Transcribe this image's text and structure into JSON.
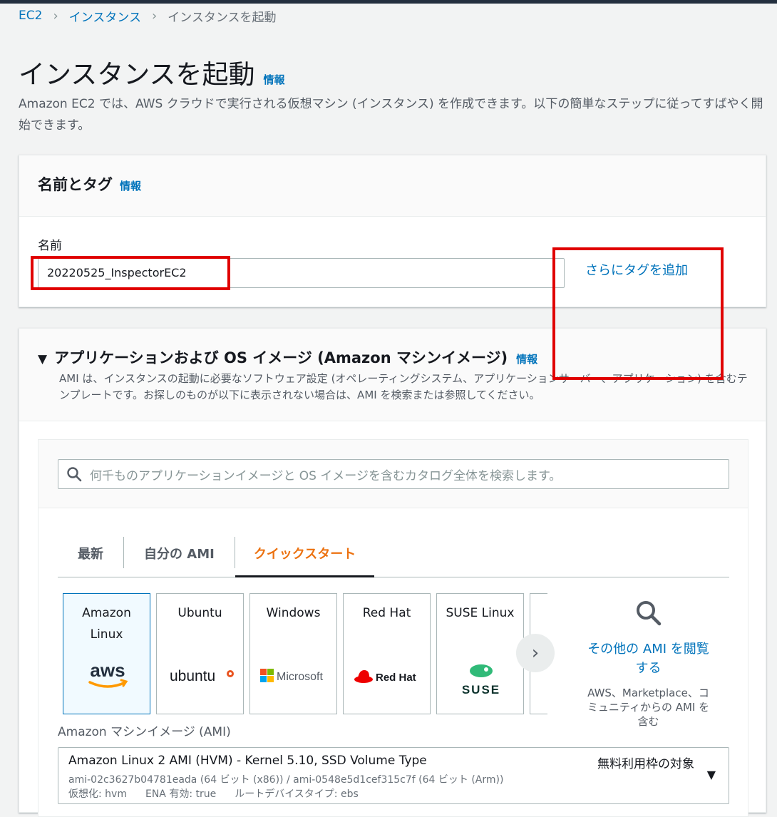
{
  "breadcrumb": {
    "item1": "EC2",
    "item2": "インスタンス",
    "current": "インスタンスを起動"
  },
  "header": {
    "title": "インスタンスを起動",
    "info": "情報",
    "description": "Amazon EC2 では、AWS クラウドで実行される仮想マシン (インスタンス) を作成できます。以下の簡単なステップに従ってすばやく開始できます。"
  },
  "name_section": {
    "title": "名前とタグ",
    "info": "情報",
    "name_label": "名前",
    "name_value": "20220525_InspectorEC2",
    "add_tags": "さらにタグを追加"
  },
  "ami_section": {
    "title": "アプリケーションおよび OS イメージ (Amazon マシンイメージ)",
    "info": "情報",
    "description": "AMI は、インスタンスの起動に必要なソフトウェア設定 (オペレーティングシステム、アプリケーションサーバー、アプリケーション) を含むテンプレートです。お探しのものが以下に表示されない場合は、AMI を検索または参照してください。",
    "search_placeholder": "何千ものアプリケーションイメージと OS イメージを含むカタログ全体を検索します。",
    "tabs": [
      "最新",
      "自分の AMI",
      "クイックスタート"
    ],
    "tiles": [
      {
        "name": "Amazon Linux",
        "logo_text": "aws"
      },
      {
        "name": "Ubuntu",
        "logo_text": "ubuntu"
      },
      {
        "name": "Windows",
        "logo_text": "Microsoft"
      },
      {
        "name": "Red Hat",
        "logo_text": "Red Hat"
      },
      {
        "name": "SUSE Linux",
        "logo_text": "SUSE"
      }
    ],
    "browse_link": "その他の AMI を閲覧する",
    "browse_desc": "AWS、Marketplace、コミュニティからの AMI を含む",
    "ami_label": "Amazon マシンイメージ (AMI)",
    "selected_ami": {
      "title": "Amazon Linux 2 AMI (HVM) - Kernel 5.10, SSD Volume Type",
      "ids": "ami-02c3627b04781eada (64 ビット (x86)) / ami-0548e5d1cef315c7f (64 ビット (Arm))",
      "virtualization": "仮想化: hvm",
      "ena": "ENA 有効: true",
      "root_device": "ルートデバイスタイプ: ebs",
      "badge": "無料利用枠の対象"
    }
  },
  "colors": {
    "link": "#0073bb",
    "active_tab": "#ec7211",
    "highlight_box": "#e00000"
  }
}
